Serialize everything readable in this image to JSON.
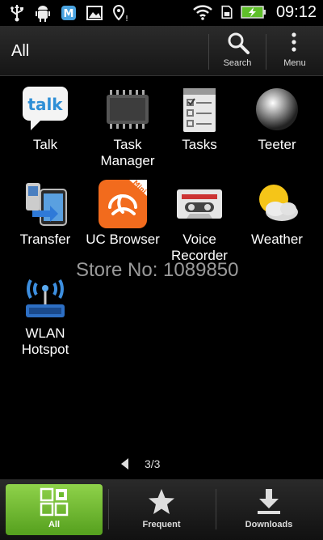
{
  "status_bar": {
    "time": "09:12",
    "left_icons": [
      "usb-icon",
      "android-debug-icon",
      "app-notification-icon",
      "image-notification-icon",
      "location-icon"
    ],
    "right_icons": [
      "wifi-icon",
      "sd-card-icon",
      "battery-charging-icon"
    ]
  },
  "header": {
    "title": "All",
    "search_label": "Search",
    "menu_label": "Menu"
  },
  "apps": [
    {
      "label": "Talk",
      "icon": "talk-icon"
    },
    {
      "label": "Task Manager",
      "icon": "task-manager-icon"
    },
    {
      "label": "Tasks",
      "icon": "tasks-icon"
    },
    {
      "label": "Teeter",
      "icon": "teeter-icon"
    },
    {
      "label": "Transfer",
      "icon": "transfer-icon"
    },
    {
      "label": "UC Browser",
      "icon": "uc-browser-icon"
    },
    {
      "label": "Voice Recorder",
      "icon": "voice-recorder-icon"
    },
    {
      "label": "Weather",
      "icon": "weather-icon"
    },
    {
      "label": "WLAN Hotspot",
      "icon": "wlan-hotspot-icon"
    }
  ],
  "watermark": "Store No: 1089850",
  "pager": {
    "text": "3/3"
  },
  "bottom_tabs": [
    {
      "label": "All",
      "active": true
    },
    {
      "label": "Frequent",
      "active": false
    },
    {
      "label": "Downloads",
      "active": false
    }
  ],
  "colors": {
    "active_tab": "#6cbb2e",
    "background": "#000000"
  }
}
